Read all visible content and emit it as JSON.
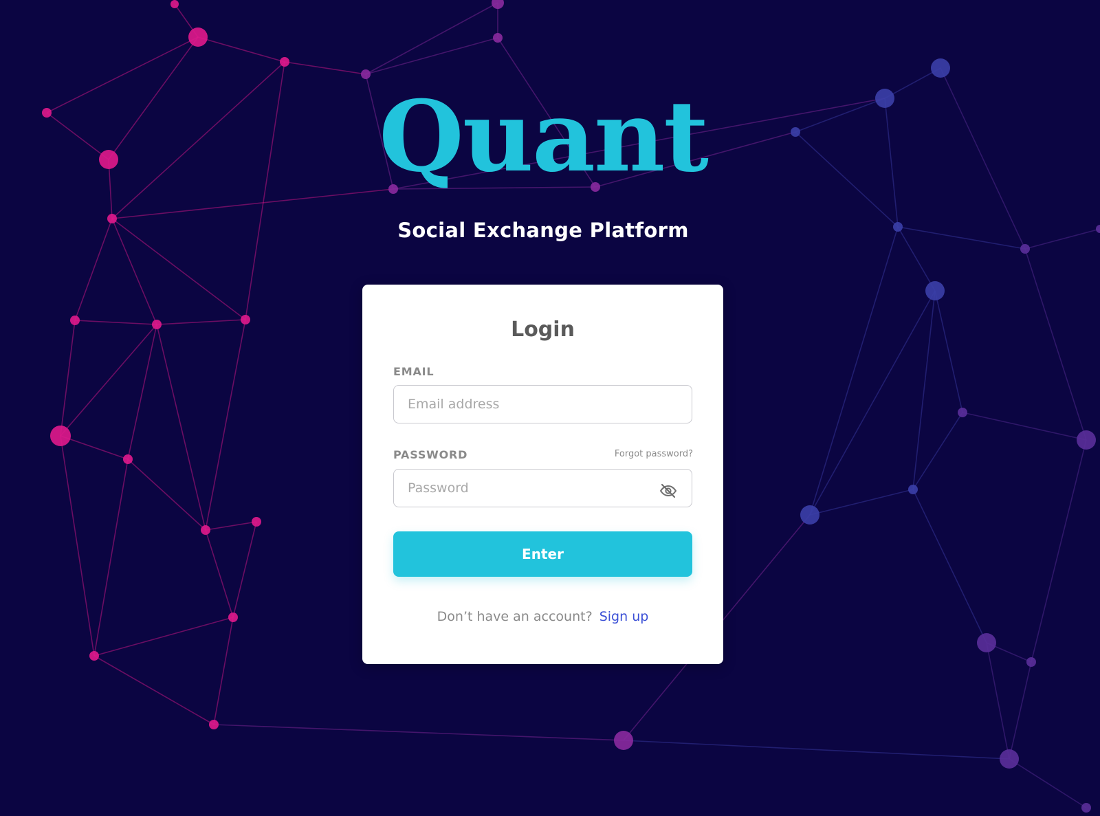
{
  "brand": {
    "name": "Quant",
    "tagline": "Social Exchange Platform"
  },
  "login": {
    "title": "Login",
    "email_label": "EMAIL",
    "email_placeholder": "Email address",
    "password_label": "PASSWORD",
    "forgot_label": "Forgot password?",
    "password_placeholder": "Password",
    "password_toggle_icon": "eye-slash-icon",
    "enter_label": "Enter",
    "signup_prompt": "Don’t have an account?",
    "signup_link": "Sign up"
  },
  "colors": {
    "background": "#0b0542",
    "accent": "#22c3dc",
    "link": "#3a4fd6",
    "node_pink": "#e0198c",
    "node_purple": "#7a2a9a",
    "node_blue": "#2f3f9a"
  }
}
